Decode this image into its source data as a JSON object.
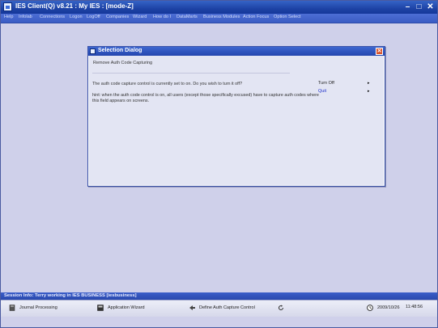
{
  "window": {
    "title": "IES Client(Q) v8.21 : My IES :      [mode-Z]",
    "minimize": "–",
    "maximize": "□",
    "close": "✕"
  },
  "menu": [
    "Help",
    "Infolab",
    "Connections",
    "Logon",
    "LogOff",
    "Companies",
    "Wizard",
    "How do I",
    "DataMarts",
    "Business Modules",
    "Action Focus",
    "Option Select"
  ],
  "dialog": {
    "title": "Selection Dialog",
    "close": "✕",
    "header": "Remove Auth Code Capturing",
    "question": "The auth code capture control is currently set to on. Do you wish to turn it off?",
    "hint": "hint: when the auth code control is on, all users (except those specifically excused) have to capture auth codes where this field appears on screens.",
    "options": [
      {
        "label": "Turn Off",
        "arrow": "▸"
      },
      {
        "label": "Quit",
        "arrow": "▸"
      }
    ]
  },
  "session": {
    "text": "Session Info: Terry working in IES BUSINESS   [iesbusiness]"
  },
  "statusbar": {
    "journal": "Journal Processing",
    "wizard": "Application Wizard",
    "define": "Define Auth Capture Control",
    "date": "2009/10/26",
    "time": "11:48:56"
  },
  "colors": {
    "titlebar": "#1e43a6",
    "workspace": "#cfd0ea",
    "dialog_close": "#d9532c",
    "quit_link": "#2233cc"
  }
}
